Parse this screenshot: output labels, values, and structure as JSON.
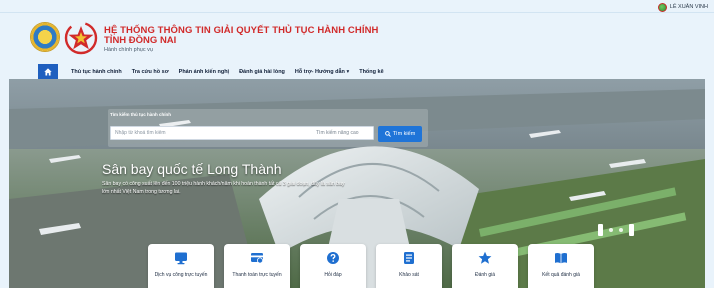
{
  "user": {
    "name": "LÊ XUÂN VINH"
  },
  "header": {
    "title_line1": "HỆ THỐNG THÔNG TIN GIẢI QUYẾT THỦ TỤC HÀNH CHÍNH",
    "title_line2": "TỈNH ĐỒNG NAI",
    "subtitle": "Hành chính phục vụ",
    "brand_color": "#d12a2a"
  },
  "nav": {
    "home_icon": "home-icon",
    "items": [
      {
        "label": "Thủ tục hành chính"
      },
      {
        "label": "Tra cứu hồ sơ"
      },
      {
        "label": "Phản ánh kiến nghị"
      },
      {
        "label": "Đánh giá hài lòng"
      },
      {
        "label": "Hỗ trợ- Hướng dẫn ▾"
      },
      {
        "label": "Thống kê"
      }
    ]
  },
  "search": {
    "title": "Tìm kiếm thủ tục hành chính",
    "placeholder": "Nhập từ khoá tìm kiếm",
    "advanced_label": "Tìm kiếm nâng cao",
    "button_label": "Tìm kiếm"
  },
  "hero": {
    "heading": "Sân bay quốc tế Long Thành",
    "description": "Sân bay có công suất lên đến 100 triệu hành khách/năm khi hoàn thành tất cả 3 giai đoạn, đây là sân bay lớn nhất Việt Nam trong tương lai."
  },
  "services": [
    {
      "label": "Dịch vụ công trực tuyến",
      "icon": "monitor-icon"
    },
    {
      "label": "Thanh toán trực tuyến",
      "icon": "payment-card-icon"
    },
    {
      "label": "Hỏi đáp",
      "icon": "question-icon"
    },
    {
      "label": "Khảo sát",
      "icon": "survey-icon"
    },
    {
      "label": "Đánh giá",
      "icon": "star-icon"
    },
    {
      "label": "Kết quả đánh giá",
      "icon": "book-icon"
    }
  ],
  "colors": {
    "accent": "#1f74d8",
    "nav_home": "#1f5fbf",
    "icon": "#1f6fd0"
  }
}
